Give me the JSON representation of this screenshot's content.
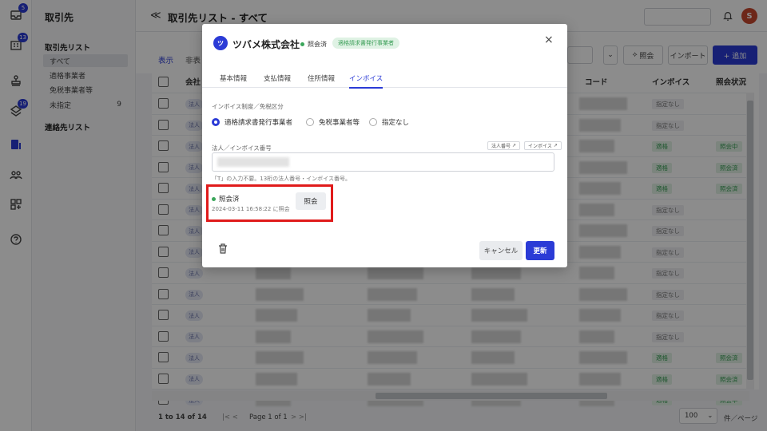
{
  "rail": {
    "items": [
      {
        "icon": "inbox-icon",
        "badge": "5"
      },
      {
        "icon": "building-icon",
        "badge": "13"
      },
      {
        "icon": "stamp-icon",
        "badge": ""
      },
      {
        "icon": "layers-icon",
        "badge": "19"
      },
      {
        "icon": "contacts-icon",
        "badge": ""
      },
      {
        "icon": "people-icon",
        "badge": ""
      },
      {
        "icon": "apps-add-icon",
        "badge": ""
      },
      {
        "icon": "help-icon",
        "badge": ""
      }
    ]
  },
  "sidebar": {
    "title": "取引先",
    "section1": "取引先リスト",
    "items": [
      {
        "label": "すべて",
        "count": ""
      },
      {
        "label": "適格事業者",
        "count": ""
      },
      {
        "label": "免税事業者等",
        "count": ""
      },
      {
        "label": "未指定",
        "count": "9"
      }
    ],
    "section2": "連絡先リスト"
  },
  "header": {
    "back": "≪",
    "title": "取引先リスト - すべて",
    "avatar": "S"
  },
  "toolbar": {
    "tabs": [
      "表示",
      "非表"
    ],
    "dropdown": "⌄",
    "verify_label": "照会",
    "import_label": "インポート",
    "add_label": "+ 追加"
  },
  "table": {
    "headers": {
      "company": "会社",
      "code": "コード",
      "invoice": "インボイス",
      "status": "照会状況"
    },
    "corp_tag": "法人",
    "rows": [
      {
        "invoice": "指定なし",
        "invoice_type": "none",
        "status": ""
      },
      {
        "invoice": "指定なし",
        "invoice_type": "none",
        "status": ""
      },
      {
        "invoice": "適格",
        "invoice_type": "ok",
        "status": "照会中"
      },
      {
        "invoice": "適格",
        "invoice_type": "ok",
        "status": "照会済"
      },
      {
        "invoice": "適格",
        "invoice_type": "ok",
        "status": "照会済"
      },
      {
        "invoice": "指定なし",
        "invoice_type": "none",
        "status": ""
      },
      {
        "invoice": "指定なし",
        "invoice_type": "none",
        "status": ""
      },
      {
        "invoice": "指定なし",
        "invoice_type": "none",
        "status": ""
      },
      {
        "invoice": "指定なし",
        "invoice_type": "none",
        "status": ""
      },
      {
        "invoice": "指定なし",
        "invoice_type": "none",
        "status": ""
      },
      {
        "invoice": "指定なし",
        "invoice_type": "none",
        "status": ""
      },
      {
        "invoice": "指定なし",
        "invoice_type": "none",
        "status": ""
      },
      {
        "invoice": "適格",
        "invoice_type": "ok",
        "status": "照会済"
      },
      {
        "invoice": "適格",
        "invoice_type": "ok",
        "status": "照会済"
      },
      {
        "invoice": "適格",
        "invoice_type": "ok",
        "status": "照会中"
      }
    ]
  },
  "footer": {
    "range": "1 to 14 of 14",
    "nav": "|<  <",
    "page": "Page 1 of 1",
    "nav_next": ">  >|",
    "per_page": "100",
    "per_page_unit": "件／ページ"
  },
  "modal": {
    "logo": "ツ",
    "title": "ツバメ株式会社",
    "status": "照会済",
    "badge": "適格請求書発行事業者",
    "close": "×",
    "tabs": [
      "基本情報",
      "支払情報",
      "住所情報",
      "インボイス"
    ],
    "invoice_section_label": "インボイス制度／免税区分",
    "radios": [
      {
        "label": "適格請求書発行事業者",
        "selected": true
      },
      {
        "label": "免税事業者等",
        "selected": false
      },
      {
        "label": "指定なし",
        "selected": false
      }
    ],
    "number_label": "法人／インボイス番号",
    "link_corp": "法人番号",
    "link_invoice": "インボイス",
    "hint": "「T」の入力不要。13桁の法人番号・インボイス番号。",
    "verify_status": "照会済",
    "verify_time": "2024-03-11 16:58:22 に照会",
    "verify_button": "照会",
    "cancel": "キャンセル",
    "update": "更新"
  },
  "colors": {
    "accent": "#2b3bd6",
    "success": "#3a9e57",
    "highlight": "#e01b1b"
  }
}
